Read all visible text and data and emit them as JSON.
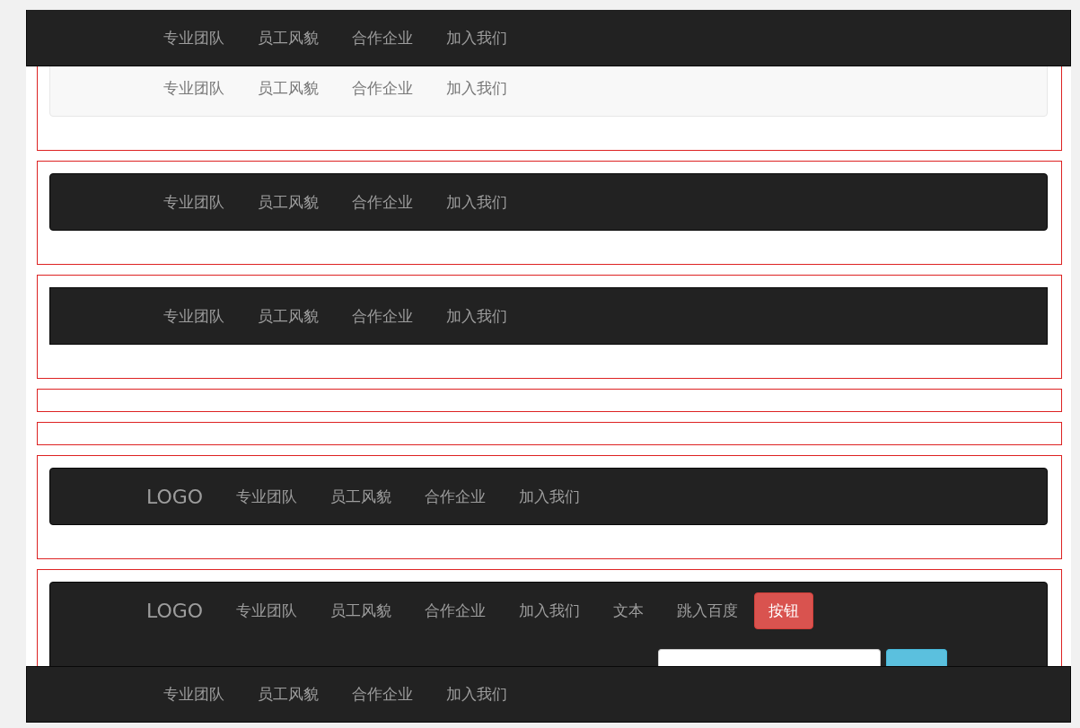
{
  "top_fixed_navbar": {
    "items": [
      {
        "kind": "link",
        "label": "专业团队"
      },
      {
        "kind": "link",
        "label": "员工风貌"
      },
      {
        "kind": "link",
        "label": "合作企业"
      },
      {
        "kind": "link",
        "label": "加入我们"
      }
    ]
  },
  "demo_boxes": [
    {
      "kind": "light-navbar",
      "navbar": {
        "items": [
          {
            "kind": "link",
            "label": "专业团队"
          },
          {
            "kind": "link",
            "label": "员工风貌"
          },
          {
            "kind": "link",
            "label": "合作企业"
          },
          {
            "kind": "link",
            "label": "加入我们"
          }
        ]
      }
    },
    {
      "kind": "dark-navbar",
      "navbar": {
        "items": [
          {
            "kind": "link",
            "label": "专业团队"
          },
          {
            "kind": "link",
            "label": "员工风貌"
          },
          {
            "kind": "link",
            "label": "合作企业"
          },
          {
            "kind": "link",
            "label": "加入我们"
          }
        ]
      }
    },
    {
      "kind": "dark-static-navbar",
      "navbar": {
        "items": [
          {
            "kind": "link",
            "label": "专业团队"
          },
          {
            "kind": "link",
            "label": "员工风貌"
          },
          {
            "kind": "link",
            "label": "合作企业"
          },
          {
            "kind": "link",
            "label": "加入我们"
          }
        ]
      }
    },
    {
      "kind": "empty"
    },
    {
      "kind": "empty"
    },
    {
      "kind": "dark-navbar",
      "navbar": {
        "brand": "LOGO",
        "items": [
          {
            "kind": "link",
            "label": "专业团队"
          },
          {
            "kind": "link",
            "label": "员工风貌"
          },
          {
            "kind": "link",
            "label": "合作企业"
          },
          {
            "kind": "link",
            "label": "加入我们"
          }
        ]
      }
    },
    {
      "kind": "dark-navbar-with-form",
      "navbar": {
        "brand": "LOGO",
        "items": [
          {
            "kind": "link",
            "label": "专业团队"
          },
          {
            "kind": "link",
            "label": "员工风貌"
          },
          {
            "kind": "link",
            "label": "合作企业"
          },
          {
            "kind": "link",
            "label": "加入我们"
          },
          {
            "kind": "text",
            "label": "文本"
          },
          {
            "kind": "link",
            "label": "跳入百度"
          },
          {
            "kind": "button",
            "label": "按钮"
          }
        ]
      }
    }
  ],
  "bottom_fixed_navbar": {
    "items": [
      {
        "kind": "link",
        "label": "专业团队"
      },
      {
        "kind": "link",
        "label": "员工风貌"
      },
      {
        "kind": "link",
        "label": "合作企业"
      },
      {
        "kind": "link",
        "label": "加入我们"
      }
    ]
  }
}
